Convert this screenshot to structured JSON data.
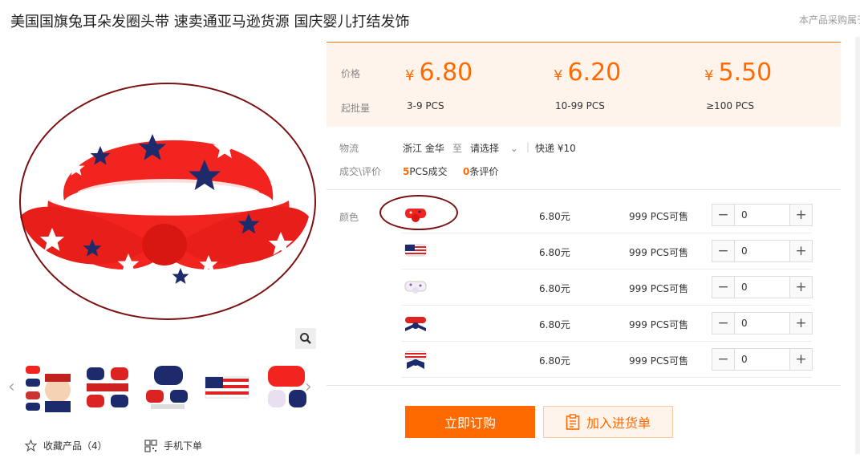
{
  "product": {
    "title": "美国国旗兔耳朵发圈头带 速卖通亚马逊货源 国庆婴儿打结发饰",
    "note": "本产品采购属于"
  },
  "price": {
    "price_label": "价格",
    "min_label": "起批量",
    "currency": "¥",
    "tiers": [
      {
        "price": "6.80",
        "min": "3-9  PCS"
      },
      {
        "price": "6.20",
        "min": "10-99  PCS"
      },
      {
        "price": "5.50",
        "min": "≥100  PCS"
      }
    ]
  },
  "shipping": {
    "label": "物流",
    "from": "浙江 金华",
    "to_word": "至",
    "select": "请选择",
    "method": "快递 ¥10"
  },
  "trade": {
    "label": "成交\\评价",
    "sold_count": "5",
    "sold_text": "PCS成交",
    "review_count": "0",
    "review_text": "条评价"
  },
  "sku": {
    "label": "颜色",
    "rows": [
      {
        "price": "6.80元",
        "stock": "999 PCS可售",
        "qty": "0",
        "variant": "red-stars-icon"
      },
      {
        "price": "6.80元",
        "stock": "999 PCS可售",
        "qty": "0",
        "variant": "flag-stripes-icon"
      },
      {
        "price": "6.80元",
        "stock": "999 PCS可售",
        "qty": "0",
        "variant": "white-stars-icon"
      },
      {
        "price": "6.80元",
        "stock": "999 PCS可售",
        "qty": "0",
        "variant": "blue-bow-icon"
      },
      {
        "price": "6.80元",
        "stock": "999 PCS可售",
        "qty": "0",
        "variant": "striped-bow-icon"
      }
    ]
  },
  "actions": {
    "buy": "立即订购",
    "cart": "加入进货单"
  },
  "footer": {
    "favorite": "收藏产品（4）",
    "mobile": "手机下单"
  },
  "colors": {
    "accent": "#ff6a00",
    "panel_bg": "#fff4ec",
    "headband_red": "#f2241f",
    "star_navy": "#1d2a6b",
    "circle_mark": "#7a1010"
  }
}
